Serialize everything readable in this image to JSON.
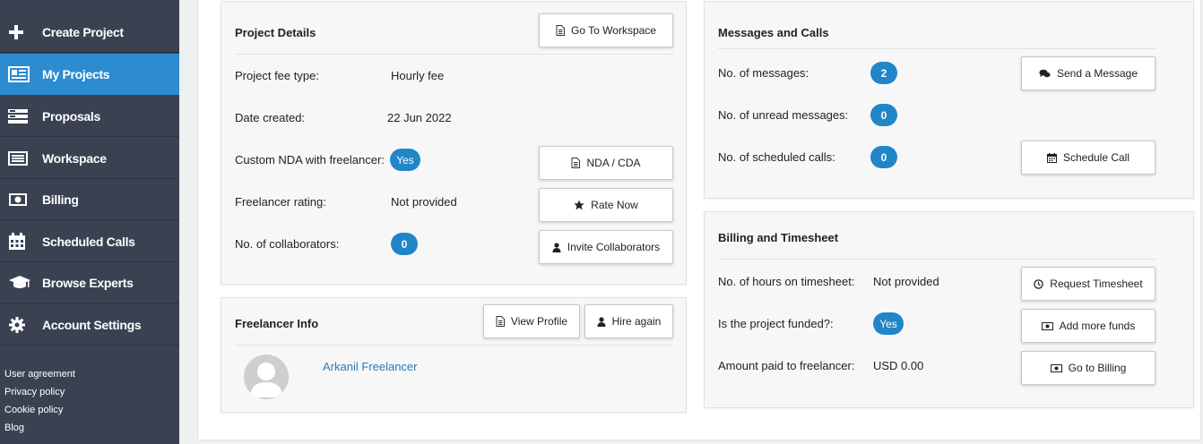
{
  "sidebar": {
    "items": [
      {
        "label": "Create Project",
        "icon": "plus-icon"
      },
      {
        "label": "My Projects",
        "icon": "projects-icon",
        "active": true
      },
      {
        "label": "Proposals",
        "icon": "proposals-icon"
      },
      {
        "label": "Workspace",
        "icon": "workspace-icon"
      },
      {
        "label": "Billing",
        "icon": "money-icon"
      },
      {
        "label": "Scheduled Calls",
        "icon": "calendar-icon"
      },
      {
        "label": "Browse Experts",
        "icon": "graduation-cap-icon"
      },
      {
        "label": "Account Settings",
        "icon": "gear-icon"
      }
    ],
    "footer_links": [
      "User agreement",
      "Privacy policy",
      "Cookie policy",
      "Blog"
    ]
  },
  "project_details": {
    "title": "Project Details",
    "go_to_workspace": "Go To Workspace",
    "fee_type_label": "Project fee type:",
    "fee_type_value": "Hourly fee",
    "date_created_label": "Date created:",
    "date_created_value": "22 Jun 2022",
    "nda_label": "Custom NDA with freelancer:",
    "nda_value": "Yes",
    "nda_button": "NDA / CDA",
    "rating_label": "Freelancer rating:",
    "rating_value": "Not provided",
    "rate_button": "Rate Now",
    "collaborators_label": "No. of collaborators:",
    "collaborators_value": "0",
    "invite_button": "Invite Collaborators"
  },
  "freelancer_info": {
    "title": "Freelancer Info",
    "view_profile": "View Profile",
    "hire_again": "Hire again",
    "name": "Arkanil Freelancer"
  },
  "messages": {
    "title": "Messages and Calls",
    "messages_label": "No. of messages:",
    "messages_value": "2",
    "send_button": "Send a Message",
    "unread_label": "No. of unread messages:",
    "unread_value": "0",
    "calls_label": "No. of scheduled calls:",
    "calls_value": "0",
    "schedule_button": "Schedule Call"
  },
  "billing": {
    "title": "Billing and Timesheet",
    "hours_label": "No. of hours on timesheet:",
    "hours_value": "Not provided",
    "request_button": "Request Timesheet",
    "funded_label": "Is the project funded?:",
    "funded_value": "Yes",
    "add_funds_button": "Add more funds",
    "paid_label": "Amount paid to freelancer:",
    "paid_value": "USD 0.00",
    "billing_button": "Go to Billing"
  },
  "colors": {
    "sidebar_bg": "#3a4251",
    "active_bg": "#2d8bd0",
    "badge": "#2086c9",
    "link": "#2a7bb8"
  }
}
